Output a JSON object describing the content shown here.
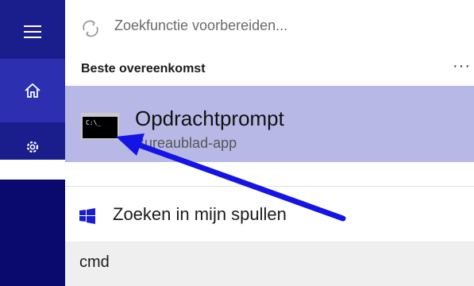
{
  "search": {
    "status_text": "Zoekfunctie voorbereiden..."
  },
  "best_match": {
    "section_title": "Beste overeenkomst",
    "more_label": "···",
    "app_name": "Opdrachtprompt",
    "app_type": "Bureaublad-app",
    "app_icon": "command-prompt-icon"
  },
  "search_mine": {
    "label": "Zoeken in mijn spullen",
    "icon": "windows-logo-icon"
  },
  "query": {
    "value": "cmd"
  },
  "rail": {
    "icons": [
      "hamburger-menu-icon",
      "home-icon",
      "settings-icon"
    ]
  },
  "colors": {
    "rail": "#1a1d8c",
    "rail_active": "#2b2fb0",
    "result_highlight": "#b8b8e6",
    "annotation_arrow": "#1414e6",
    "windows_logo": "#1a1dd0"
  }
}
